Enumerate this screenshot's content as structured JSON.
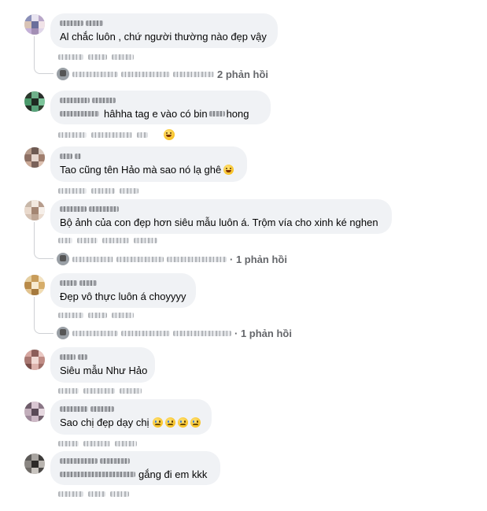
{
  "comments": [
    {
      "id": "c1",
      "text": "Al chắc luôn , chứ người thường nào đẹp vậy",
      "reply_count": "2 phản hồi",
      "emoji": ""
    },
    {
      "id": "c2",
      "text": "hâhha tag e vào có bin",
      "text_after": "hong",
      "emoji": ""
    },
    {
      "id": "c3",
      "text": "Tao cũng tên Hảo mà sao nó lạ ghê",
      "emoji": "laugh"
    },
    {
      "id": "c4",
      "text": "Bộ ảnh của con đẹp hơn siêu mẫu luôn á. Trộm vía cho xinh ké nghen",
      "reply_count": "· 1 phản hồi",
      "emoji": ""
    },
    {
      "id": "c5",
      "text": "Đẹp vô thực luôn á choyyyy",
      "reply_count": "· 1 phản hồi",
      "emoji": ""
    },
    {
      "id": "c6",
      "text": "Siêu mẫu Như Hảo",
      "emoji": ""
    },
    {
      "id": "c7",
      "text": "Sao chị đẹp dạy chị",
      "emoji": "sad4"
    },
    {
      "id": "c8",
      "text": "gắng đi em kkk",
      "emoji": ""
    }
  ],
  "colors": {
    "bubble": "#f0f2f5",
    "muted": "#65676b",
    "thread_line": "#ced0d4"
  }
}
